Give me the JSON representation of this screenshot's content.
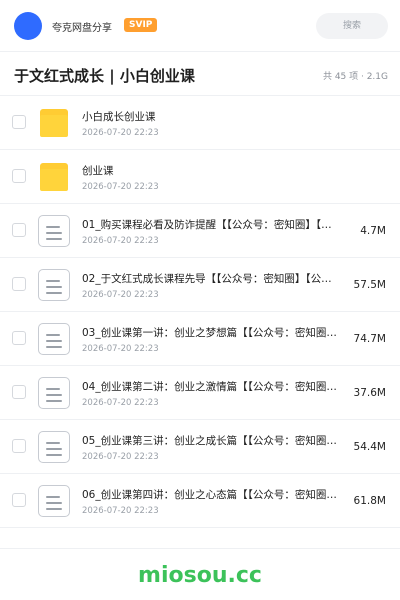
{
  "header": {
    "site_name": "夸克网盘分享",
    "badge": "SVIP",
    "search_placeholder": "搜索"
  },
  "share": {
    "title": "于文红式成长 | 小白创业课",
    "meta": "共 45 项 · 2.1G"
  },
  "files": [
    {
      "type": "folder",
      "name": "小白成长创业课",
      "date": "2026-07-20 22:23",
      "size": ""
    },
    {
      "type": "folder",
      "name": "创业课",
      "date": "2026-07-20 22:23",
      "size": ""
    },
    {
      "type": "doc",
      "name": "01_购买课程必看及防诈提醒【【公众号：密知圈】【…",
      "date": "2026-07-20 22:23",
      "size": "4.7M"
    },
    {
      "type": "doc",
      "name": "02_于文红式成长课程先导【【公众号：密知圈】【公…",
      "date": "2026-07-20 22:23",
      "size": "57.5M"
    },
    {
      "type": "doc",
      "name": "03_创业课第一讲：创业之梦想篇【【公众号：密知圈…",
      "date": "2026-07-20 22:23",
      "size": "74.7M"
    },
    {
      "type": "doc",
      "name": "04_创业课第二讲：创业之激情篇【【公众号：密知圈…",
      "date": "2026-07-20 22:23",
      "size": "37.6M"
    },
    {
      "type": "doc",
      "name": "05_创业课第三讲：创业之成长篇【【公众号：密知圈…",
      "date": "2026-07-20 22:23",
      "size": "54.4M"
    },
    {
      "type": "doc",
      "name": "06_创业课第四讲：创业之心态篇【【公众号：密知圈…",
      "date": "2026-07-20 22:23",
      "size": "61.8M"
    }
  ],
  "footer": {
    "watermark": "miosou.cc"
  },
  "colors": {
    "accent": "#2f6bff",
    "badge": "#ff9f2f",
    "folder": "#ffd43b",
    "watermark": "#3cc25a"
  }
}
